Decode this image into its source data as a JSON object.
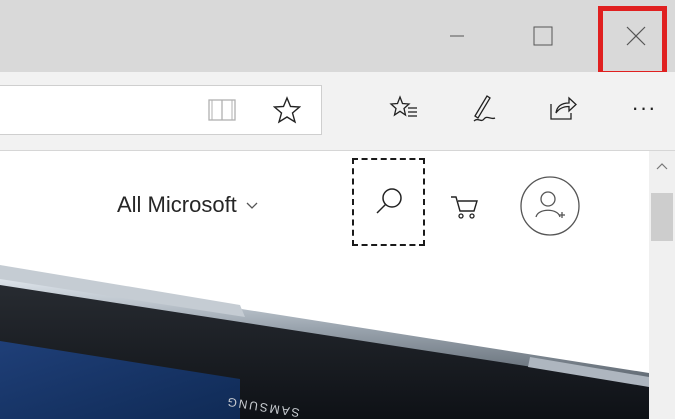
{
  "window": {
    "controls": {
      "minimize_icon": "minimize-icon",
      "maximize_icon": "maximize-icon",
      "close_icon": "close-icon",
      "close_highlight_color": "#e02020"
    }
  },
  "toolbar": {
    "reading_view_icon": "reading-view-icon",
    "favorite_icon": "star-icon",
    "favorites_hub_icon": "favorites-list-icon",
    "web_note_icon": "pen-icon",
    "share_icon": "share-icon",
    "more_label": "···"
  },
  "page": {
    "nav": {
      "all_microsoft_label": "All Microsoft",
      "search_icon": "search-icon",
      "cart_icon": "cart-icon",
      "account_icon": "account-add-icon"
    },
    "hero": {
      "brand_text": "SAMSUNG"
    }
  },
  "colors": {
    "titlebar": "#d9d9d9",
    "toolbar": "#f2f2f2",
    "focus_outline": "#1a1a1a"
  }
}
